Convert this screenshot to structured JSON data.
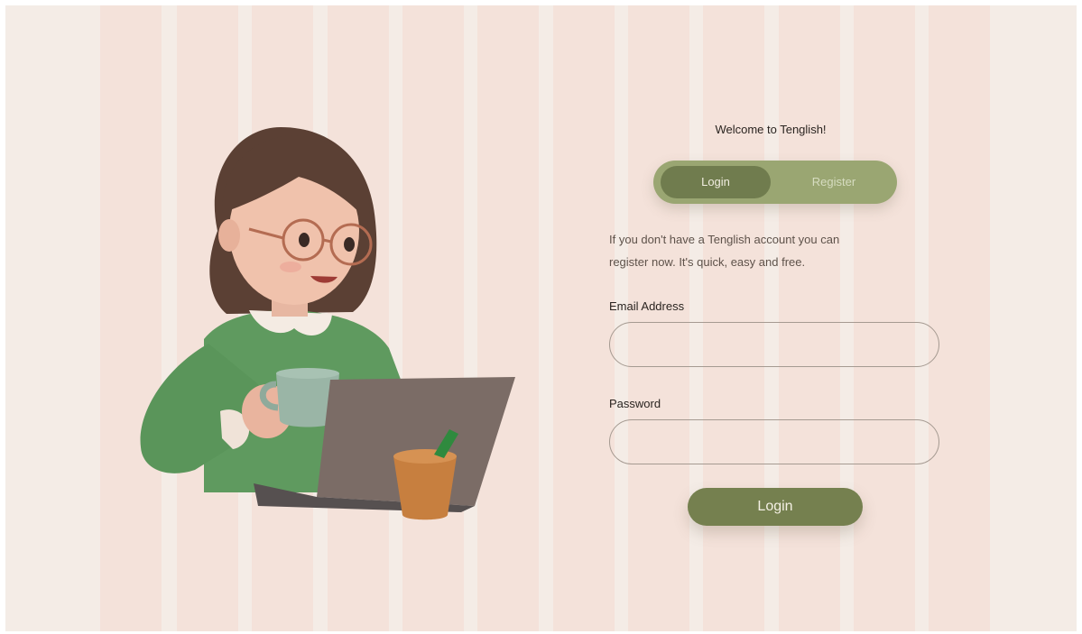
{
  "colors": {
    "background": "#f4ece6",
    "stripe": "#f4e2da",
    "accent": "#75804f",
    "switcher_bg": "#9aa672",
    "text": "#2a2420"
  },
  "illustration": {
    "icon": "girl-with-laptop-and-coffee-illustration"
  },
  "auth": {
    "welcome": "Welcome to Tenglish!",
    "tabs": {
      "login": "Login",
      "register": "Register"
    },
    "intro_line1": "If you don't have a Tenglish account you can",
    "intro_line2": "register now. It's quick, easy and free.",
    "email": {
      "label": "Email Address",
      "value": "",
      "placeholder": ""
    },
    "password": {
      "label": "Password",
      "value": "",
      "placeholder": ""
    },
    "submit_label": "Login"
  }
}
